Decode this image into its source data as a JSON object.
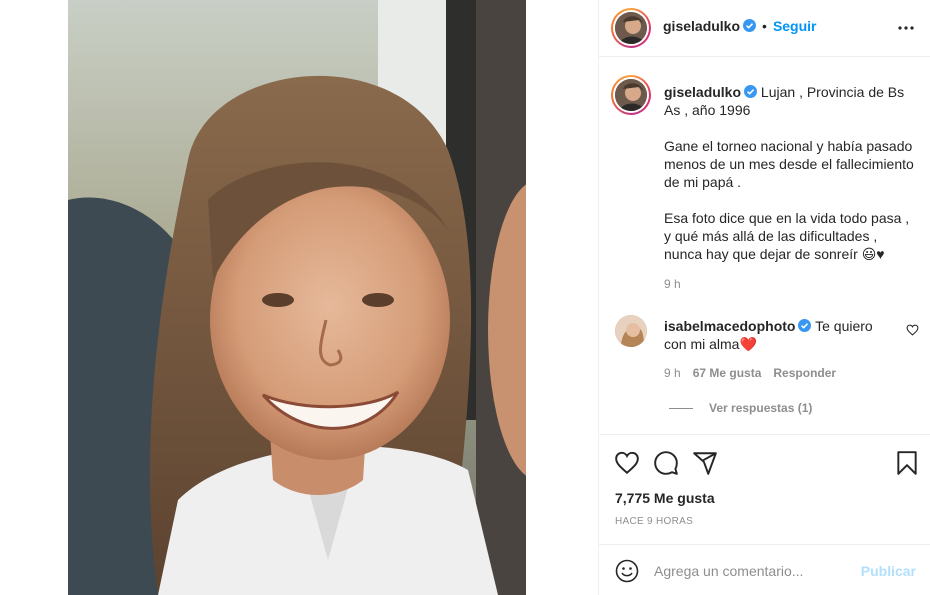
{
  "post": {
    "photo_alt": "photo",
    "author": {
      "username": "giseladulko",
      "verified": true
    },
    "header": {
      "separator": "•",
      "follow_label": "Seguir",
      "more_icon": "more-horizontal-icon"
    },
    "caption": {
      "username": "giseladulko",
      "location_text": "Lujan , Provincia de Bs As , año 1996",
      "paragraph_1": "Gane el torneo nacional y había pasado menos de un mes desde el fallecimiento de mi papá .",
      "paragraph_2": "Esa foto dice que en la vida todo pasa , y qué más allá de las dificultades , nunca hay que dejar de sonreír 😃♥",
      "time": "9 h"
    },
    "comments": [
      {
        "username": "isabelmacedophoto",
        "verified": true,
        "text": "Te quiero con mi alma❤️",
        "time": "9 h",
        "likes": "67 Me gusta",
        "reply_label": "Responder",
        "view_replies": "Ver respuestas (1)"
      }
    ],
    "actions": {
      "icons": [
        "heart-icon",
        "comment-icon",
        "share-icon",
        "bookmark-icon"
      ],
      "likes_text": "7,775 Me gusta",
      "ago_text": "Hace 9 horas"
    },
    "add_comment": {
      "placeholder": "Agrega un comentario...",
      "post_label": "Publicar",
      "emoji_icon": "emoji-icon"
    }
  },
  "colors": {
    "accent": "#0095f6",
    "text": "#262626",
    "muted": "#8e8e8e",
    "border": "#efefef",
    "post_disabled": "#b2dffc",
    "verified": "#3897f0"
  }
}
